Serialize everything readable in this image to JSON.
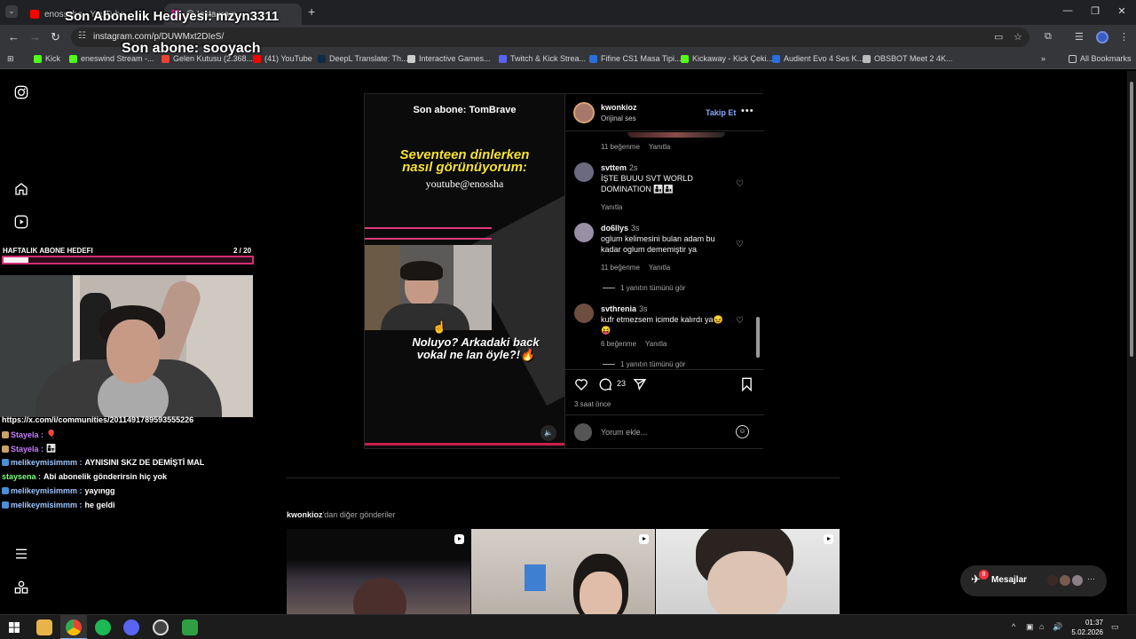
{
  "browser": {
    "tabs": [
      {
        "title": "enosssha - YouTube",
        "active": false,
        "color": "#ff0000"
      },
      {
        "title": "@ Instagram",
        "active": true,
        "color": "#d6249f"
      }
    ],
    "url": "instagram.com/p/DUWMxt2DIeS/",
    "bookmarks": [
      "Kick",
      "eneswind Stream -...",
      "Gelen Kutusu (2.368...",
      "(41) YouTube",
      "DeepL Translate: Th...",
      "Interactive Games...",
      "Twitch & Kick Strea...",
      "Fifine CS1 Masa Tipi...",
      "Kickaway - Kick Çeki...",
      "Audient Evo 4 Ses K...",
      "OBSBOT Meet 2 4K...",
      "All Bookmarks"
    ]
  },
  "overlay": {
    "gift_text": "Son Abonelik Hediyesi: mzyn3311",
    "last_sub_text": "Son abone: sooyach",
    "goal_label": "HAFTALIK ABONE HEDEFI",
    "goal_count": "2 / 20",
    "goal_progress": 0.1,
    "link": "https://x.com/i/communities/2011491789593555226",
    "chat": [
      {
        "user": "Stayela",
        "message": "🎈",
        "color": "#c77dff"
      },
      {
        "user": "Stayela",
        "message": "👩‍👧",
        "color": "#c77dff"
      },
      {
        "user": "melikeymisimmm",
        "message": "AYNISINI SKZ DE DEMİŞTİ MAL",
        "color": "#9fc5ff"
      },
      {
        "user": "staysena",
        "message": "Abi abonelik gönderirsin hiç yok",
        "color": "#7dff7d"
      },
      {
        "user": "melikeymisimmm",
        "message": "yayıngg",
        "color": "#9fc5ff"
      },
      {
        "user": "melikeymisimmm",
        "message": "he geldi",
        "color": "#9fc5ff"
      }
    ]
  },
  "post": {
    "video": {
      "sub_title": "Son abone: TomBrave",
      "caption_main": "Seventeen dinlerken nasıl görünüyorum:",
      "caption_handle": "youtube@enossha",
      "caption_bottom": "Noluyo? Arkadaki back vokal ne lan öyle?!🔥",
      "mute_icon": "speaker-muted-icon"
    },
    "author": {
      "username": "kwonkioz",
      "audio": "Orijinal ses",
      "follow_label": "Takip Et"
    },
    "comments": [
      {
        "user": "",
        "time": "",
        "text": "",
        "likes": "11 beğenme",
        "reply": "Yanıtla",
        "partial": true
      },
      {
        "user": "svttem",
        "time": "2s",
        "text": "İŞTE BUUU SVT WORLD DOMINATION 👨‍👦👨‍👦",
        "likes": "",
        "reply": "Yanıtla"
      },
      {
        "user": "do6llys",
        "time": "3s",
        "text": "oglum kelimesini bulan adam bu kadar oglum dememiştir ya",
        "likes": "11 beğenme",
        "reply": "Yanıtla",
        "view_replies": "1 yanıtın tümünü gör"
      },
      {
        "user": "svthrenia",
        "time": "3s",
        "text": "kufr etmezsem icimde kalırdı ya😖😝",
        "likes": "6 beğenme",
        "reply": "Yanıtla",
        "view_replies": "1 yanıtın tümünü gör"
      }
    ],
    "comment_count": "23",
    "time_ago": "3 saat önce",
    "add_comment_placeholder": "Yorum ekle..."
  },
  "more_posts": {
    "author": "kwonkioz",
    "title_suffix": "'dan diğer gönderiler"
  },
  "messages": {
    "label": "Mesajlar",
    "badge": "8"
  },
  "taskbar": {
    "time": "01:37",
    "date": "5.02.2026"
  }
}
